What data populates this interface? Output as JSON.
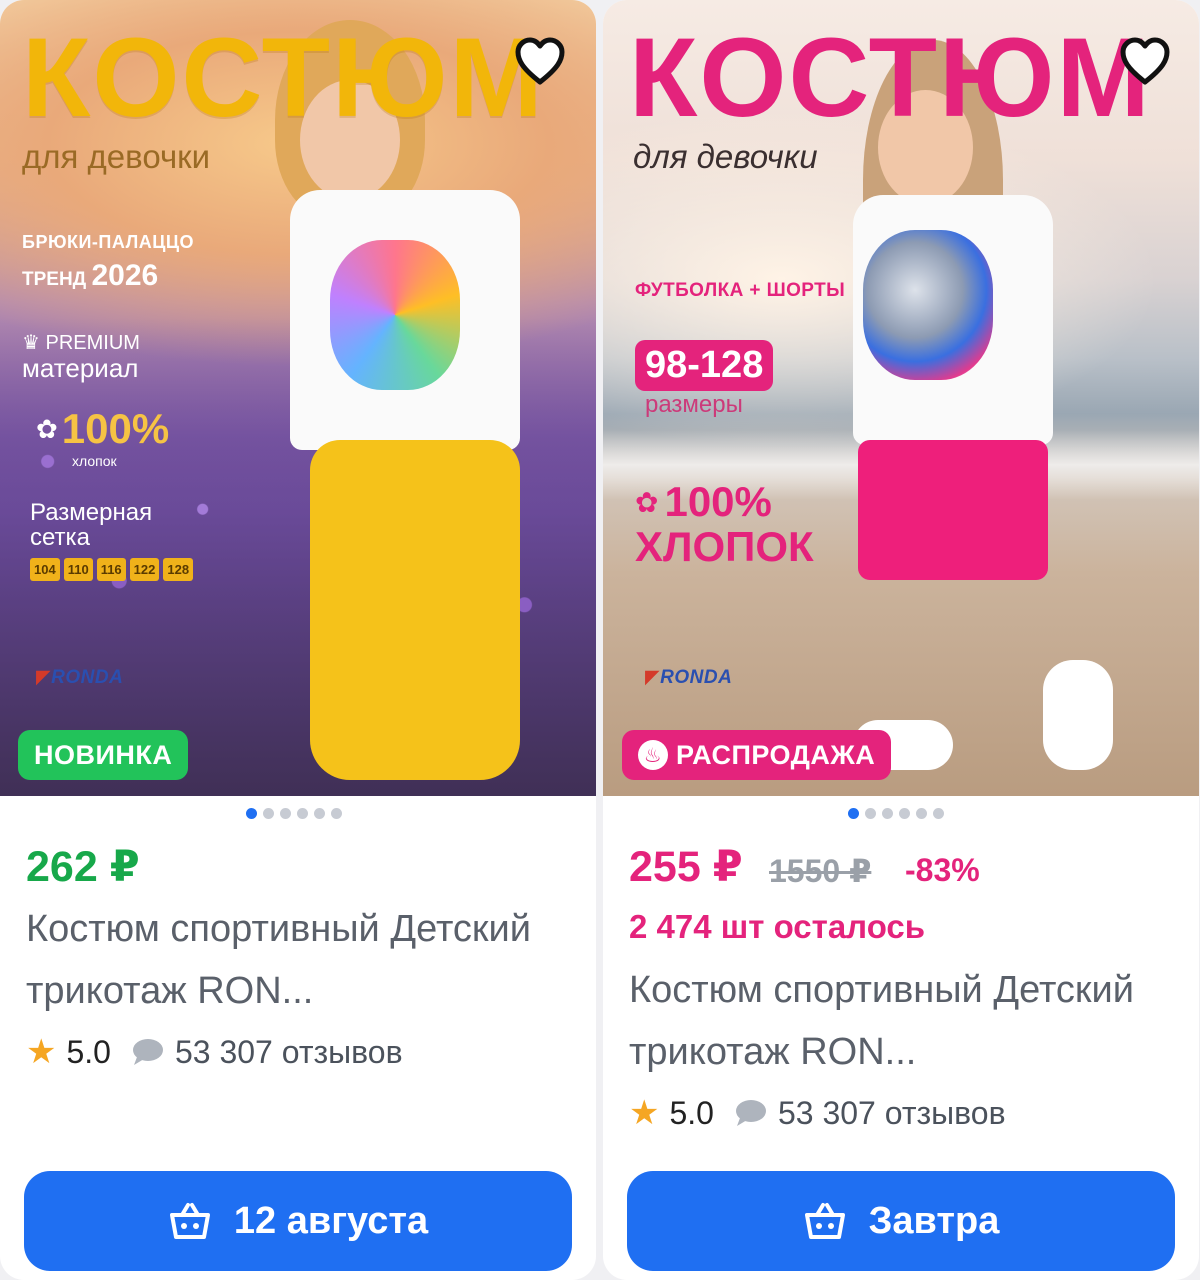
{
  "cards": [
    {
      "image": {
        "title": "КОСТЮМ",
        "subtitle": "для девочки",
        "line1": "БРЮКИ-ПАЛАЦЦО",
        "trend_label": "ТРЕНД",
        "trend_year": "2026",
        "premium": "PREMIUM",
        "material": "материал",
        "percent": "100%",
        "cotton": "хлопок",
        "size_grid": "Размерная",
        "size_grid2": "сетка",
        "sizes": [
          "104",
          "110",
          "116",
          "122",
          "128"
        ],
        "brand": "RONDA",
        "badge": "НОВИНКА"
      },
      "price": "262 ₽",
      "name": "Костюм спортивный Детский трикотаж RON...",
      "rating": "5.0",
      "reviews": "53 307 отзывов",
      "cta": "12 августа"
    },
    {
      "image": {
        "title": "КОСТЮМ",
        "subtitle": "для девочки",
        "set": "ФУТБОЛКА + ШОРТЫ",
        "size_range": "98-128",
        "sizes_label": "размеры",
        "percent": "100%",
        "cotton": "ХЛОПОК",
        "brand": "RONDA",
        "badge": "РАСПРОДАЖА"
      },
      "price": "255 ₽",
      "old_price": "1550 ₽",
      "discount": "-83%",
      "stock": "2 474 шт осталось",
      "name": "Костюм спортивный Детский трикотаж RON...",
      "rating": "5.0",
      "reviews": "53 307 отзывов",
      "cta": "Завтра"
    }
  ],
  "colors": {
    "accent_blue": "#1f6ff2",
    "new_green": "#22c35a",
    "sale_pink": "#e4237c",
    "price_green": "#17a84a",
    "star": "#f5a623"
  },
  "icons": {
    "favorite": "heart-icon",
    "rating": "star-icon",
    "reviews": "comment-icon",
    "cart": "basket-icon",
    "sale": "fire-icon",
    "premium": "crown-icon",
    "cotton": "cotton-flower-icon"
  }
}
